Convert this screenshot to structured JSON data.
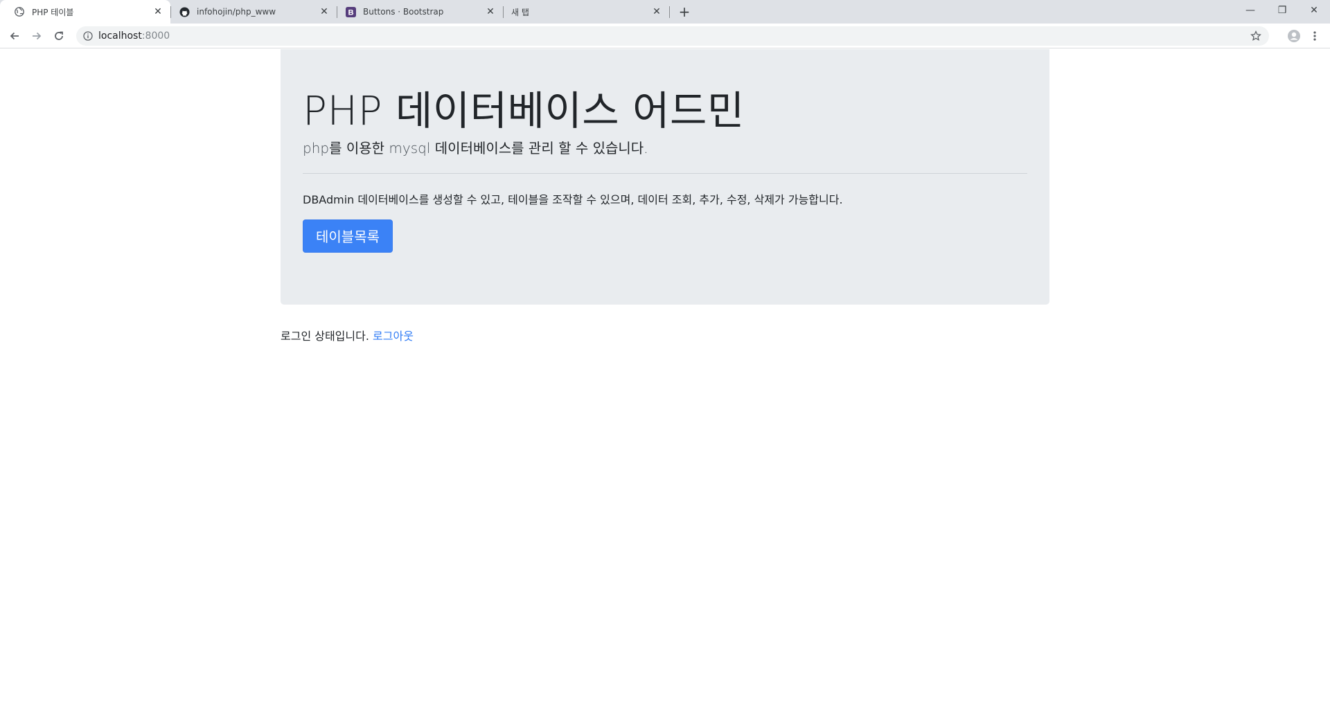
{
  "browser": {
    "tabs": [
      {
        "title": "PHP 테이블",
        "favicon": "globe-icon",
        "active": true
      },
      {
        "title": "infohojin/php_www",
        "favicon": "github-icon",
        "active": false
      },
      {
        "title": "Buttons · Bootstrap",
        "favicon": "bootstrap-icon",
        "active": false
      },
      {
        "title": "새 탭",
        "favicon": "none",
        "active": false
      }
    ],
    "close_glyph": "✕",
    "new_tab_glyph": "+",
    "address": {
      "host": "localhost",
      "port": ":8000"
    },
    "window_controls": {
      "minimize": "—",
      "restore": "❐",
      "close": "✕"
    }
  },
  "jumbotron": {
    "title": "PHP 데이터베이스 어드민",
    "lead": {
      "part1": "php",
      "part2": "를 이용한 ",
      "part3": "mysql",
      "part4": " 데이터베이스를 관리 할 수 있습니다."
    },
    "description": "DBAdmin 데이터베이스를 생성할 수 있고, 테이블을 조작할 수 있으며, 데이터 조회, 추가, 수정, 삭제가 가능합니다.",
    "button_label": "테이블목록"
  },
  "status": {
    "text": "로그인 상태입니다. ",
    "logout_label": "로그아웃"
  },
  "colors": {
    "primary": "#3b82f6",
    "jumbotron_bg": "#e9ecef",
    "link": "#2f7bf5"
  }
}
